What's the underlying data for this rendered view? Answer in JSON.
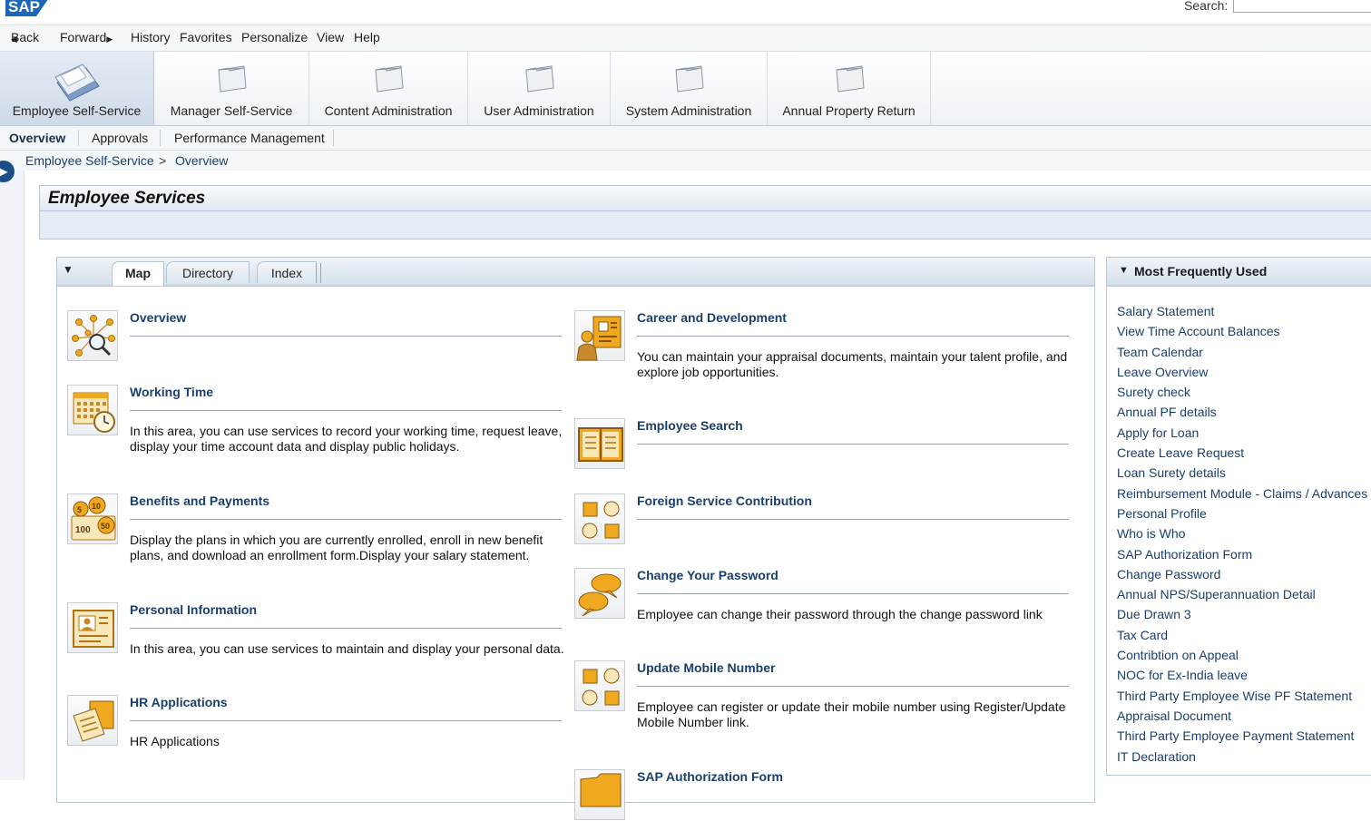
{
  "header": {
    "logo_text": "SAP",
    "search_label": "Search:",
    "search_value": ""
  },
  "nav": {
    "back": "Back",
    "forward": "Forward",
    "history": "History",
    "favorites": "Favorites",
    "personalize": "Personalize",
    "view": "View",
    "help": "Help"
  },
  "roles": [
    {
      "label": "Employee Self-Service",
      "icon": "folders-icon"
    },
    {
      "label": "Manager Self-Service",
      "icon": "folder-icon"
    },
    {
      "label": "Content Administration",
      "icon": "folder-icon"
    },
    {
      "label": "User Administration",
      "icon": "folder-icon"
    },
    {
      "label": "System Administration",
      "icon": "folder-icon"
    },
    {
      "label": "Annual Property Return",
      "icon": "folder-icon"
    }
  ],
  "subtabs": [
    "Overview",
    "Approvals",
    "Performance Management"
  ],
  "breadcrumb": {
    "root": "Employee Self-Service",
    "separator": ">",
    "current": "Overview"
  },
  "page": {
    "title": "Employee Services"
  },
  "map_tabs": [
    "Map",
    "Directory",
    "Index"
  ],
  "services_left": [
    {
      "title": "Overview",
      "description": "",
      "icon": "overview-network-icon"
    },
    {
      "title": "Working Time",
      "description": "In this area, you can use services to record your working time, request leave, display your time account data and display public holidays.",
      "icon": "calendar-clock-icon"
    },
    {
      "title": "Benefits and Payments",
      "description": "Display the plans in which you are currently enrolled, enroll in new benefit plans, and download an enrollment form.Display your salary statement.",
      "icon": "coins-icon"
    },
    {
      "title": "Personal Information",
      "description": "In this area, you can use services to maintain and display your personal data.",
      "icon": "id-card-icon"
    },
    {
      "title": "HR Applications",
      "description": "HR Applications",
      "icon": "documents-icon"
    }
  ],
  "services_right": [
    {
      "title": "Career and Development",
      "description": "You can maintain your appraisal documents, maintain your talent profile, and explore job opportunities.",
      "icon": "career-icon"
    },
    {
      "title": "Employee Search",
      "description": "",
      "icon": "address-book-icon"
    },
    {
      "title": "Foreign Service Contribution",
      "description": "",
      "icon": "shapes-icon"
    },
    {
      "title": "Change Your Password",
      "description": "Employee can change their password through the change password link",
      "icon": "speech-bubbles-icon"
    },
    {
      "title": "Update Mobile Number",
      "description": "Employee can register or update their mobile number using Register/Update Mobile Number link.",
      "icon": "shapes-icon"
    },
    {
      "title": "SAP Authorization Form",
      "description": "",
      "icon": "folder-icon"
    }
  ],
  "mfu": {
    "title": "Most Frequently Used",
    "items": [
      "Salary Statement",
      "View Time Account Balances",
      "Team Calendar",
      "Leave Overview",
      "Surety check",
      "Annual PF details",
      "Apply for Loan",
      "Create Leave Request",
      "Loan Surety details",
      "Reimbursement Module - Claims / Advances",
      "Personal Profile",
      "Who is Who",
      "SAP Authorization Form",
      "Change Password",
      "Annual NPS/Superannuation Detail",
      "Due Drawn 3",
      "Tax Card",
      "Contribtion on Appeal",
      "NOC for Ex-India leave",
      "Third Party Employee Wise PF Statement",
      "Appraisal Document",
      "Third Party Employee Payment Statement",
      "IT Declaration"
    ]
  },
  "colors": {
    "link": "#1b3f6b",
    "brand": "#1c4e86",
    "icon_gold": "#f0a81e"
  }
}
